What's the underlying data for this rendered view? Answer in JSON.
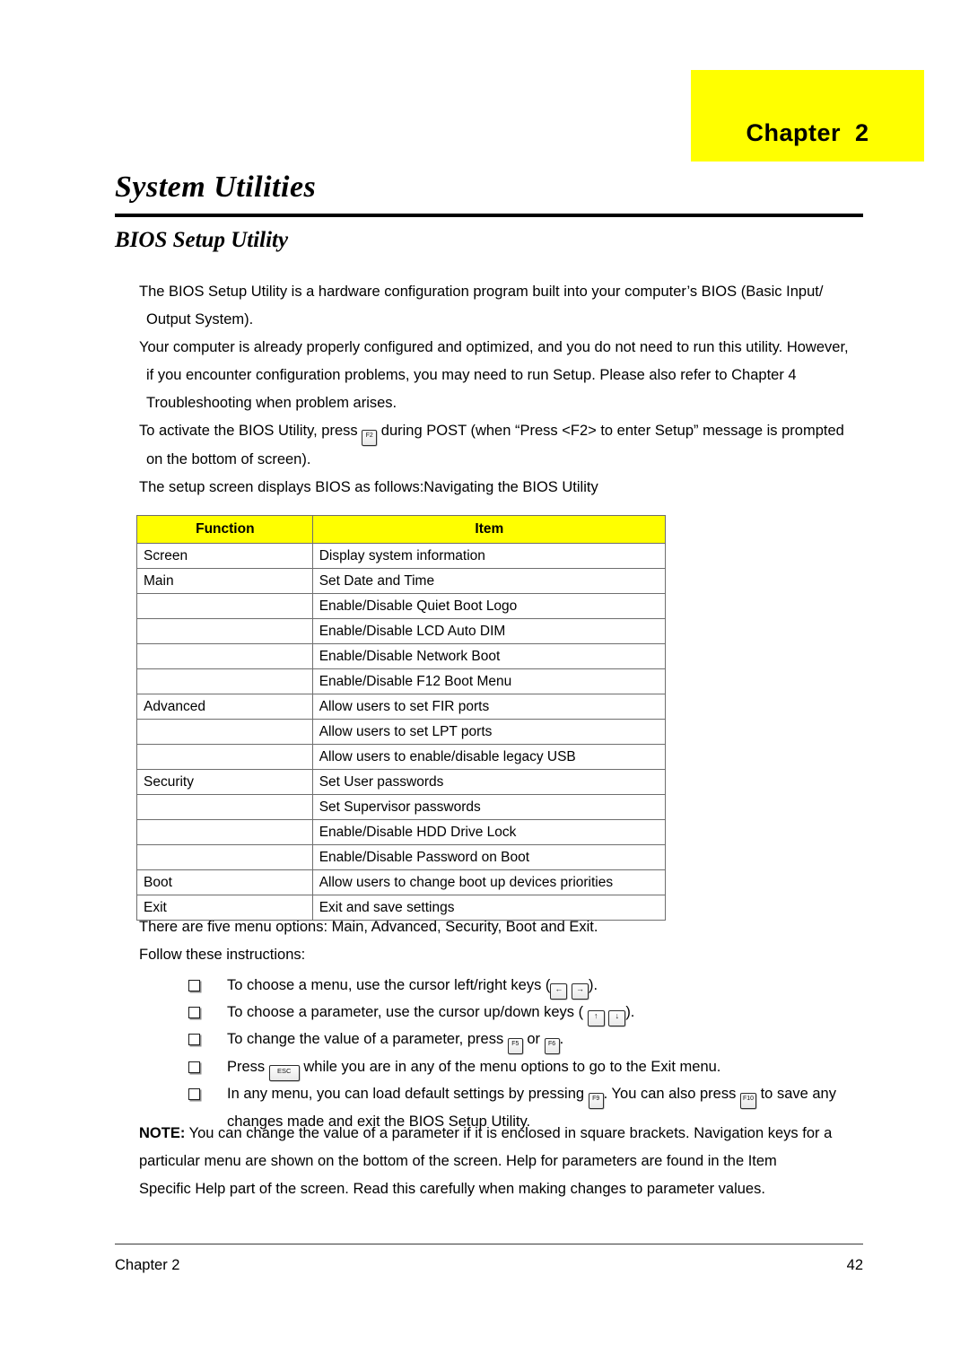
{
  "banner": {
    "chapter_label": "Chapter  2"
  },
  "headings": {
    "doc_title": "System Utilities",
    "section_title": "BIOS Setup Utility"
  },
  "intro": {
    "p1": "The BIOS Setup Utility is a hardware configuration program built into your computer’s BIOS (Basic Input/",
    "p1b": "Output System).",
    "p2": "Your computer is already properly configured and optimized, and you do not need to run this utility. However,",
    "p2b": "if you encounter configuration problems, you may need to run Setup.  Please also refer to Chapter 4",
    "p2c": " Troubleshooting when problem arises.",
    "p3_before_key": "To activate the BIOS Utility, press ",
    "p3_key": "F2",
    "p3_after_key": " during POST (when “Press <F2> to enter Setup” message is prompted",
    "p3b": " on the bottom of screen).",
    "p4": "The setup screen displays BIOS as follows:Navigating the BIOS Utility"
  },
  "table": {
    "headers": [
      "Function",
      "Item"
    ],
    "rows": [
      [
        "Screen",
        "Display system information"
      ],
      [
        "Main",
        "Set Date and Time"
      ],
      [
        "",
        "Enable/Disable Quiet Boot Logo"
      ],
      [
        "",
        "Enable/Disable LCD Auto DIM"
      ],
      [
        "",
        "Enable/Disable Network Boot"
      ],
      [
        "",
        "Enable/Disable F12 Boot Menu"
      ],
      [
        "Advanced",
        "Allow users to set FIR ports"
      ],
      [
        "",
        "Allow users to set LPT ports"
      ],
      [
        "",
        "Allow users to enable/disable legacy USB"
      ],
      [
        "Security",
        "Set User passwords"
      ],
      [
        "",
        "Set Supervisor passwords"
      ],
      [
        "",
        "Enable/Disable HDD Drive Lock"
      ],
      [
        "",
        "Enable/Disable Password on Boot"
      ],
      [
        "Boot",
        "Allow users to change boot up devices priorities"
      ],
      [
        "Exit",
        "Exit and save settings"
      ]
    ]
  },
  "instructions": {
    "menu_options_line": "There are five menu options: Main, Advanced, Security, Boot and Exit.",
    "follow_line": "Follow these instructions:",
    "bullets": [
      {
        "before": "To choose a menu, use the cursor left/right keys (",
        "keys": [
          "←",
          "→"
        ],
        "after": ")."
      },
      {
        "before": "To choose a parameter, use the cursor up/down keys ( ",
        "keys": [
          "↑",
          "↓"
        ],
        "after": ")."
      },
      {
        "before": "To change the value of a parameter, press ",
        "keys": [
          "F5",
          "F6"
        ],
        "middle": " or ",
        "after": "."
      },
      {
        "before": "Press ",
        "keys": [
          "ESC"
        ],
        "after": " while you are in any of the menu options to go to the Exit menu."
      },
      {
        "before": "In any menu, you can load default settings by pressing ",
        "keys": [
          "F9",
          "F10"
        ],
        "middle": ". You can also press ",
        "after": " to save any",
        "second_line": " changes made and exit the BIOS Setup Utility."
      }
    ]
  },
  "note": {
    "label": "NOTE:",
    "line1": " You can change the value of a parameter if it is enclosed in square brackets. Navigation keys for a",
    "line2": " particular menu are shown on the bottom of the screen. Help for parameters are found in the Item",
    "line3": "Specific Help part of the screen. Read this carefully when making changes to parameter values."
  },
  "footer": {
    "left": "Chapter 2",
    "page_number": "42"
  },
  "colors": {
    "highlight_yellow": "#ffff00",
    "text_black": "#000000",
    "rule_black": "#000000"
  }
}
